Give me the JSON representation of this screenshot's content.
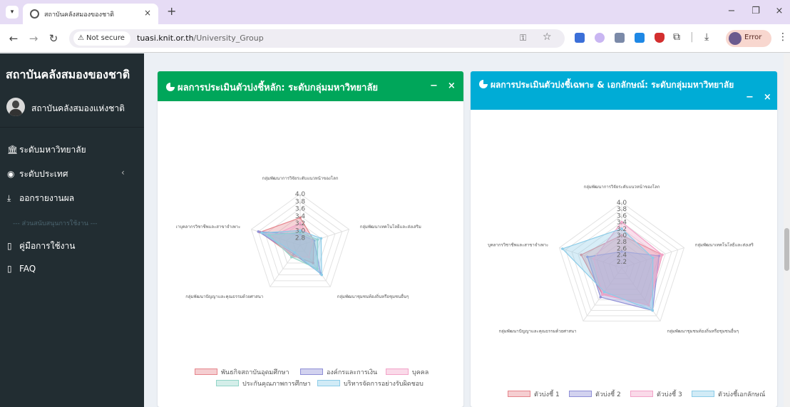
{
  "browser": {
    "tab_title": "สถาบันคลังสมองของชาติ",
    "tab_close": "×",
    "new_tab": "+",
    "security_label": "Not secure",
    "url_host": "tuasi.knit.or.th",
    "url_path": "/University_Group",
    "profile_label": "Error",
    "window_controls": [
      "−",
      "❐",
      "×"
    ]
  },
  "sidebar": {
    "brand": "สถาบันคลังสมองของชาติ",
    "user_name": "สถาบันคลังสมองแห่งชาติ",
    "items": [
      {
        "label": "ระดับมหาวิทยาลัย",
        "icon": "institution-icon"
      },
      {
        "label": "ระดับประเทศ",
        "icon": "globe-icon",
        "caret": "‹"
      },
      {
        "label": "ออกรายงานผล",
        "icon": "download-icon"
      }
    ],
    "section_header": "--- ส่วนสนับสนุนการใช้งาน ---",
    "support_items": [
      {
        "label": "คู่มือการใช้งาน",
        "icon": "file-icon"
      },
      {
        "label": "FAQ",
        "icon": "file-icon"
      }
    ]
  },
  "panels": [
    {
      "title": "ผลการประเมินตัวบ่งชี้หลัก: ระดับกลุ่มมหาวิทยาลัย",
      "header_color": "#00a65a",
      "minimize": "−",
      "close": "×"
    },
    {
      "title": "ผลการประเมินตัวบ่งชี้เฉพาะ & เอกลักษณ์: ระดับกลุ่มมหาวิทยาลัย",
      "header_color": "#00acd6",
      "minimize": "−",
      "close": "×"
    }
  ],
  "chart_data": [
    {
      "type": "radar",
      "axes": [
        "กลุ่มพัฒนาการวิจัยระดับแนวหน้าของโลก",
        "กลุ่มพัฒนาเทคโนโลยีและส่งเสริม",
        "กลุ่มพัฒนาชุมชนท้องถิ่นหรือชุมชนอื่นๆ",
        "กลุ่มพัฒนาปัญญาและคุณธรรมด้วยศาสนา",
        "เาบุคลากรวิชาชีพและสาขาจำเพาะ"
      ],
      "r_ticks": [
        "2.8",
        "3.0",
        "3.2",
        "3.4",
        "3.6",
        "3.8",
        "4.0"
      ],
      "r_range": [
        2.6,
        4.0
      ],
      "series": [
        {
          "name": "พันธกิจสถาบันอุดมศึกษา",
          "color": "#e6858c",
          "values": [
            3.35,
            3.0,
            3.2,
            2.95,
            3.75
          ]
        },
        {
          "name": "องค์กรและการเงิน",
          "color": "#8f8fd6",
          "values": [
            2.9,
            3.0,
            3.55,
            2.9,
            3.8
          ]
        },
        {
          "name": "บุคคล",
          "color": "#f2a3c8",
          "values": [
            3.2,
            2.95,
            3.0,
            3.0,
            3.4
          ]
        },
        {
          "name": "ประกันคุณภาพการศึกษา",
          "color": "#93d5c8",
          "values": [
            2.95,
            3.1,
            3.4,
            3.0,
            3.5
          ]
        },
        {
          "name": "บริหารจัดการอย่างรับผิดชอบ",
          "color": "#8ccce8",
          "values": [
            3.0,
            3.2,
            3.6,
            2.85,
            3.7
          ]
        }
      ]
    },
    {
      "type": "radar",
      "axes": [
        "กลุ่มพัฒนาการวิจัยระดับแนวหน้าของโลก",
        "กลุ่มพัฒนาเทคโนโลยีและส่งเสริ",
        "กลุ่มพัฒนาชุมชนท้องถิ่นหรือชุมชนอื่นๆ",
        "กลุ่มพัฒนาปัญญาและคุณธรรมด้วยศาสนา",
        "บุคลากรวิชาชีพและสาขาจำเพาะ"
      ],
      "r_ticks": [
        "2.2",
        "2.4",
        "2.6",
        "2.8",
        "3.0",
        "3.2",
        "3.4",
        "3.6",
        "3.8",
        "4.0"
      ],
      "r_range": [
        2.0,
        4.0
      ],
      "series": [
        {
          "name": "ตัวบ่งชี้ 1",
          "color": "#e6858c",
          "values": [
            3.0,
            3.3,
            3.4,
            3.0,
            3.3
          ]
        },
        {
          "name": "ตัวบ่งชี้ 2",
          "color": "#8f8fd6",
          "values": [
            2.5,
            3.2,
            3.6,
            3.1,
            3.1
          ]
        },
        {
          "name": "ตัวบ่งชี้ 3",
          "color": "#f2a3c8",
          "values": [
            3.4,
            3.3,
            3.4,
            3.0,
            2.9
          ]
        },
        {
          "name": "ตัวบ่งชี้เอกลักษณ์",
          "color": "#8ccce8",
          "values": [
            3.2,
            3.0,
            3.6,
            2.9,
            3.9
          ]
        }
      ]
    }
  ]
}
